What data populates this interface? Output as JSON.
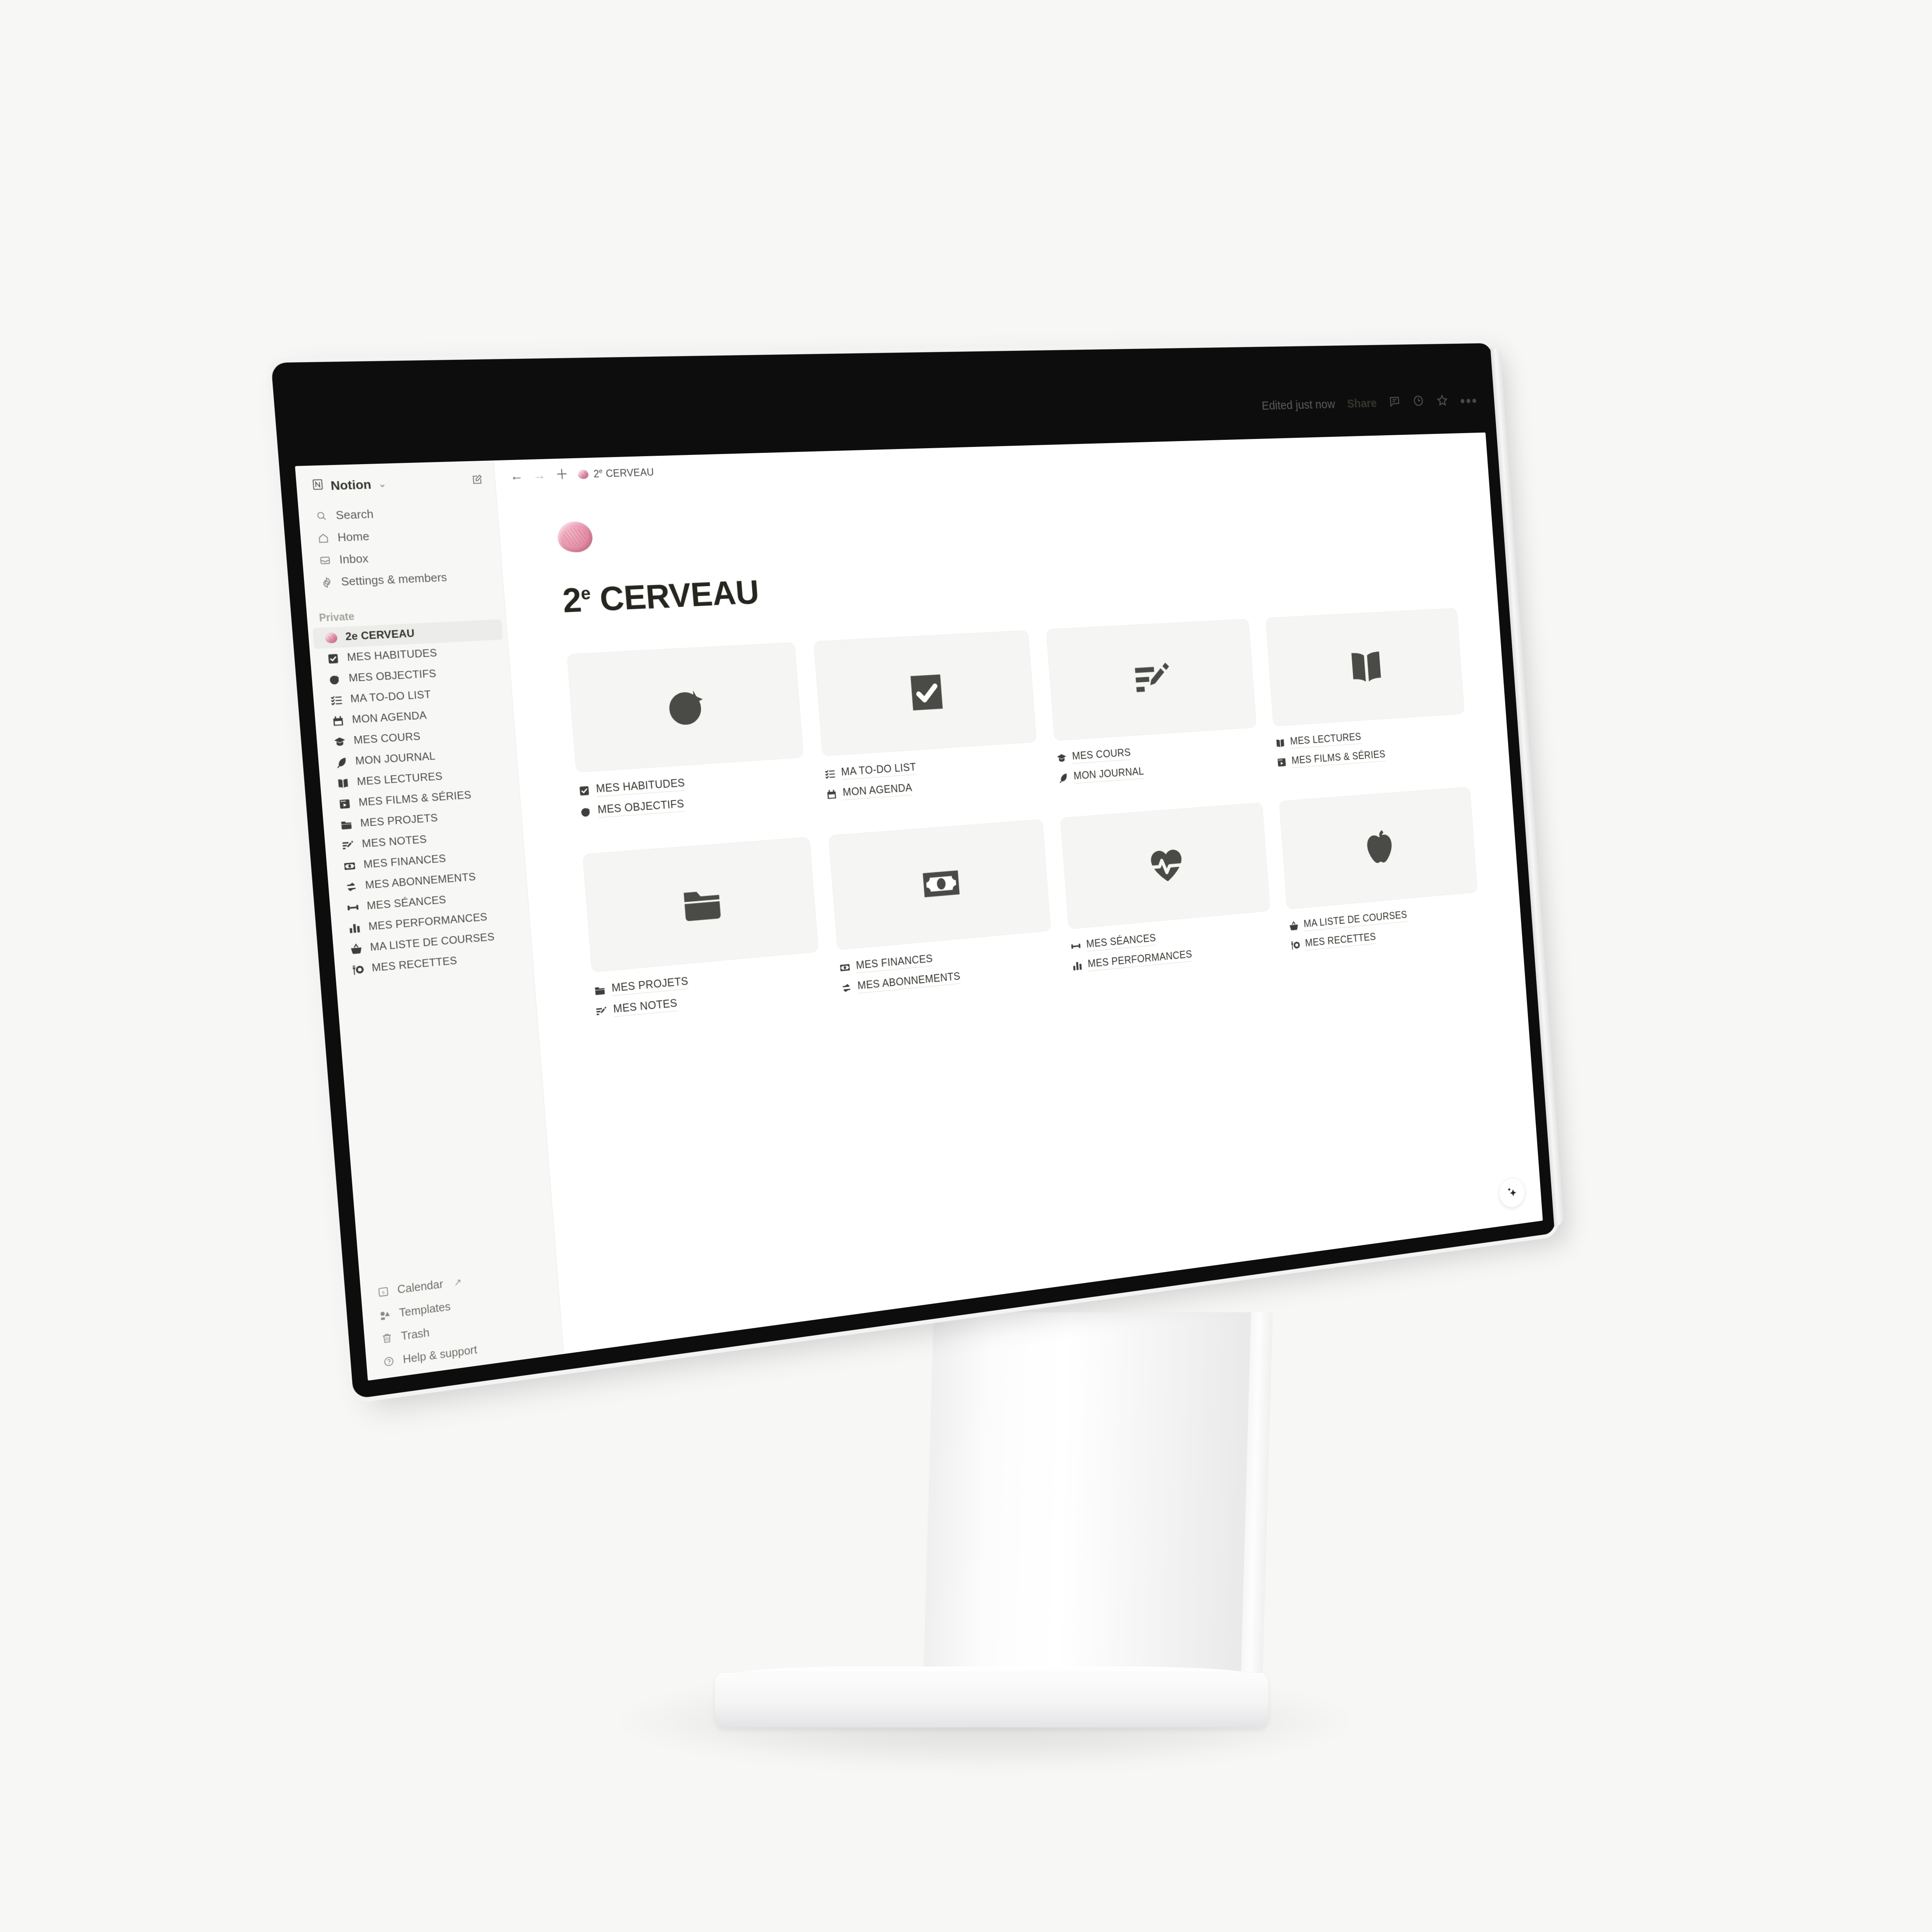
{
  "window": {
    "edited_status": "Edited just now",
    "share_label": "Share",
    "icons": [
      "comment-icon",
      "history-clock-icon",
      "star-icon",
      "more-horizontal-icon"
    ]
  },
  "topbar": {
    "back_icon": "arrow-left-icon",
    "forward_icon": "arrow-right-icon",
    "new_icon": "plus-icon",
    "breadcrumb_emoji": "brain-emoji",
    "breadcrumb": "2e CERVEAU",
    "breadcrumb_sup": "e",
    "breadcrumb_num": "2"
  },
  "sidebar": {
    "workspace": "Notion",
    "compose_icon": "compose-icon",
    "nav": [
      {
        "label": "Search",
        "icon": "search-icon"
      },
      {
        "label": "Home",
        "icon": "home-icon"
      },
      {
        "label": "Inbox",
        "icon": "inbox-icon"
      },
      {
        "label": "Settings & members",
        "icon": "gear-icon"
      }
    ],
    "section_label": "Private",
    "pages": [
      {
        "label": "2e CERVEAU",
        "icon": "brain-emoji",
        "active": true
      },
      {
        "label": "MES HABITUDES",
        "icon": "checkbox-icon"
      },
      {
        "label": "MES OBJECTIFS",
        "icon": "target-icon"
      },
      {
        "label": "MA TO-DO LIST",
        "icon": "checklist-icon"
      },
      {
        "label": "MON AGENDA",
        "icon": "calendar-icon"
      },
      {
        "label": "MES COURS",
        "icon": "graduation-cap-icon"
      },
      {
        "label": "MON JOURNAL",
        "icon": "feather-icon"
      },
      {
        "label": "MES LECTURES",
        "icon": "open-book-icon"
      },
      {
        "label": "MES FILMS & SÉRIES",
        "icon": "film-icon"
      },
      {
        "label": "MES PROJETS",
        "icon": "folder-icon"
      },
      {
        "label": "MES NOTES",
        "icon": "note-edit-icon"
      },
      {
        "label": "MES FINANCES",
        "icon": "banknote-icon"
      },
      {
        "label": "MES ABONNEMENTS",
        "icon": "repeat-icon"
      },
      {
        "label": "MES SÉANCES",
        "icon": "dumbbell-icon"
      },
      {
        "label": "MES PERFORMANCES",
        "icon": "bar-chart-icon"
      },
      {
        "label": "MA LISTE DE COURSES",
        "icon": "basket-icon"
      },
      {
        "label": "MES RECETTES",
        "icon": "fork-plate-icon"
      }
    ],
    "footer": [
      {
        "label": "Calendar",
        "icon": "calendar-6-icon",
        "external": "↗"
      },
      {
        "label": "Templates",
        "icon": "templates-icon",
        "external": ""
      },
      {
        "label": "Trash",
        "icon": "trash-icon",
        "external": ""
      },
      {
        "label": "Help & support",
        "icon": "help-circle-icon",
        "external": ""
      }
    ]
  },
  "page": {
    "emoji": "brain-emoji",
    "title_num": "2",
    "title_sup": "e",
    "title_rest": " CERVEAU",
    "ai_button_icon": "sparkles-icon",
    "cards": [
      {
        "card_icon": "target-icon",
        "links": [
          {
            "label": "MES HABITUDES",
            "icon": "checkbox-icon"
          },
          {
            "label": "MES OBJECTIFS",
            "icon": "target-icon"
          }
        ]
      },
      {
        "card_icon": "checkbox-icon",
        "links": [
          {
            "label": "MA TO-DO LIST",
            "icon": "checklist-icon"
          },
          {
            "label": "MON AGENDA",
            "icon": "calendar-icon"
          }
        ]
      },
      {
        "card_icon": "note-edit-icon",
        "links": [
          {
            "label": "MES COURS",
            "icon": "graduation-cap-icon"
          },
          {
            "label": "MON JOURNAL",
            "icon": "feather-icon"
          }
        ]
      },
      {
        "card_icon": "open-book-icon",
        "links": [
          {
            "label": "MES LECTURES",
            "icon": "open-book-icon"
          },
          {
            "label": "MES FILMS & SÉRIES",
            "icon": "film-icon"
          }
        ]
      },
      {
        "card_icon": "folder-icon",
        "links": [
          {
            "label": "MES PROJETS",
            "icon": "folder-icon"
          },
          {
            "label": "MES NOTES",
            "icon": "note-edit-icon"
          }
        ]
      },
      {
        "card_icon": "banknote-icon",
        "links": [
          {
            "label": "MES FINANCES",
            "icon": "banknote-icon"
          },
          {
            "label": "MES ABONNEMENTS",
            "icon": "repeat-icon"
          }
        ]
      },
      {
        "card_icon": "heart-pulse-icon",
        "links": [
          {
            "label": "MES SÉANCES",
            "icon": "dumbbell-icon"
          },
          {
            "label": "MES PERFORMANCES",
            "icon": "bar-chart-icon"
          }
        ]
      },
      {
        "card_icon": "apple-icon",
        "links": [
          {
            "label": "MA LISTE DE COURSES",
            "icon": "basket-icon"
          },
          {
            "label": "MES RECETTES",
            "icon": "fork-plate-icon"
          }
        ]
      }
    ]
  },
  "colors": {
    "page_bg": "#ffffff",
    "sidebar_bg": "#f7f7f5",
    "card_bg": "#f5f5f4",
    "icon_dark": "#4a4a46",
    "text": "#37352f",
    "scene_bg": "#f7f7f6",
    "bezel": "#0d0d0d"
  }
}
